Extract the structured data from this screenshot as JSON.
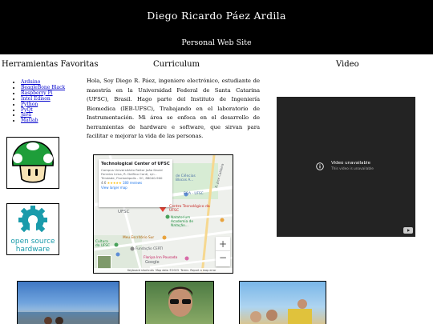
{
  "header": {
    "title": "Diego Ricardo Páez Ardila",
    "subtitle": "Personal Web Site"
  },
  "columns": {
    "tools": "Herramientas Favoritas",
    "cv": "Curriculum",
    "video": "Video"
  },
  "tools": [
    "Arduino",
    "BeagleBone Black",
    "Raspberry Pi",
    "Intel Edison",
    "Python",
    "PyQt",
    "Java",
    "Matlab"
  ],
  "about": "Hola, Soy Diego R. Páez, ingeniero electrónico, estudiante de maestría en la Universidad Federal de Santa Catarina (UFSC), Brasil. Hago parte del Instituto de Ingeniería Biomedica (IEB-UFSC), Trabajando en el laboratorio de Instrumentación. Mi área se enfoca en el desarrollo de herramientas de hardware e software, que sirvan para facilitar e mejorar la vida de las personas.",
  "oshw_label_1": "open source",
  "oshw_label_2": "hardware",
  "map": {
    "place_name": "Technological Center of UFSC",
    "address": "Campus Universitário Reitor João David Ferreira Lima, R. Delfino Conti, s/n - Trindade, Florianópolis - SC, 88040-900",
    "rating": "4.6",
    "stars": "★★★★★",
    "reviews": "180 reviews",
    "view_larger": "View larger map",
    "labels": {
      "ciencias": "de Ciências Blocos A...",
      "eqa": "EQA - UFSC",
      "ufsc": "UFSC",
      "centro": "Centro Tecnológico da UFSC",
      "natatorium": "Natatorium Academia de Natação...",
      "escritorio": "Meu Escritório Sur",
      "cultura": "Cultura da UFSC",
      "fundacao": "Fundação CERTI",
      "floripa": "Floripa Inn Pousada",
      "rua": "R. Jose Caldeira",
      "google": "Google"
    },
    "footer": {
      "shortcuts": "Keyboard shortcuts",
      "mapdata": "Map data ©2023",
      "terms": "Terms",
      "report": "Report a map error"
    }
  },
  "video": {
    "title": "Video unavailable",
    "subtitle": "This video is unavailable"
  }
}
